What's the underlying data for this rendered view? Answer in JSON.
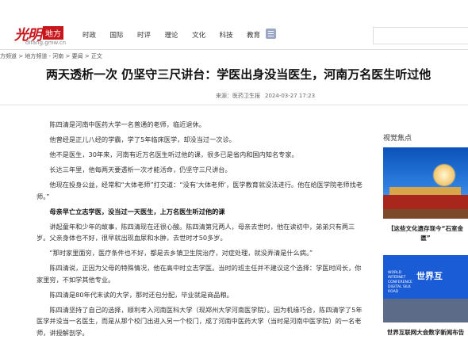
{
  "header": {
    "logo_text": "光明",
    "logo_badge": "地方",
    "logo_domain": "difang.gmw.cn",
    "nav": [
      "时政",
      "国际",
      "时评",
      "理论",
      "文化",
      "科技",
      "教育"
    ]
  },
  "breadcrumb": "方频道 > 地方频道 - 河南 > 要闻 > 正文",
  "article": {
    "title": "两天透析一次 仍坚守三尺讲台：学医出身没当医生，河南万名医生听过他",
    "source": "来源：医药卫生报",
    "datetime": "2024-03-27 17:23",
    "paragraphs": [
      "陈四清是河南中医药大学一名普通的老师，临近退休。",
      "他曾经是正儿八经的学霸，学了5年临床医学，却没当过一次诊。",
      "他不是医生，30年来，河南有近万名医生听过他的课，很多已是省内和国内知名专家。",
      "长达三年里，他每两天要透析一次才能活命，仍坚守三尺讲台。",
      "他现在投身公益，经常和“大体老师”打交道：“没有‘大体老师’，医学教育就没法进行。他在给医学院老师找老师。”",
      "母亲早亡立志学医，没当过一天医生，上万名医生听过他的课",
      "讲起童年和少年的故事，陈四清现在还很心酸。陈四清第兄两人，母亲去世时，他在读初中，弟弟只有两三岁。父亲身体也不好，很早就出现血尿和水肿，去世时才50多岁。",
      "“那时家里面穷，医疗条件也不好，都是去乡镇卫生院治疗，对症处理，就没弄清是什么病。”",
      "陈四清说，正因为父母的特殊情况，他在高中时立志学医。当时的班主任并不建议这个选择：学医时间长，你家里穷，不如学其他专业。",
      "陈四清是80年代末读的大学，那时还包分配，毕业就是商品粮。",
      "陈四清坚持了自己的选择，顺利考入河南医科大学（现郑州大学河南医学院）。因为机缘巧合，陈四清学了5年医学并没当一名医生，而是从那个校门出进入另一个校门，成了河南中医药大学（当时是河南中医学院）的一名老师，讲授解剖学。"
    ]
  },
  "sidebar": {
    "title": "视觉焦点",
    "items": [
      {
        "caption": "【这些文化遗存现今“石室金匮”"
      },
      {
        "caption": "世界互联网大会数字新闻布告",
        "image_text": "世界互",
        "image_small": "WORLD INTERNET CONFERENCE DIGITAL SILK ROAD"
      }
    ]
  },
  "colors": {
    "brand_red": "#c8161d",
    "title": "#111111"
  }
}
